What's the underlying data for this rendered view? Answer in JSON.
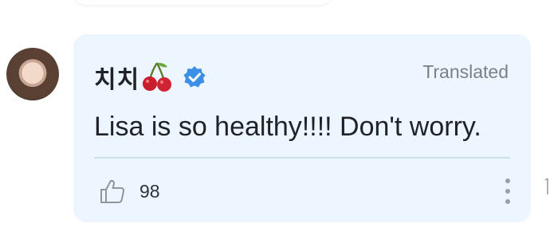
{
  "comment": {
    "author": "치치",
    "author_emoji": "cherry-emoji",
    "verified_icon": "verified-badge-icon",
    "translated_label": "Translated",
    "text": "Lisa is so healthy!!!! Don't worry.",
    "likes": "98",
    "like_icon": "thumbs-up-icon",
    "more_icon": "more-vertical-icon"
  },
  "colors": {
    "card_background": "#edf6fe",
    "verified_badge": "#3b8fe6",
    "divider": "#c9e1ea",
    "muted_text": "#7b8085"
  }
}
